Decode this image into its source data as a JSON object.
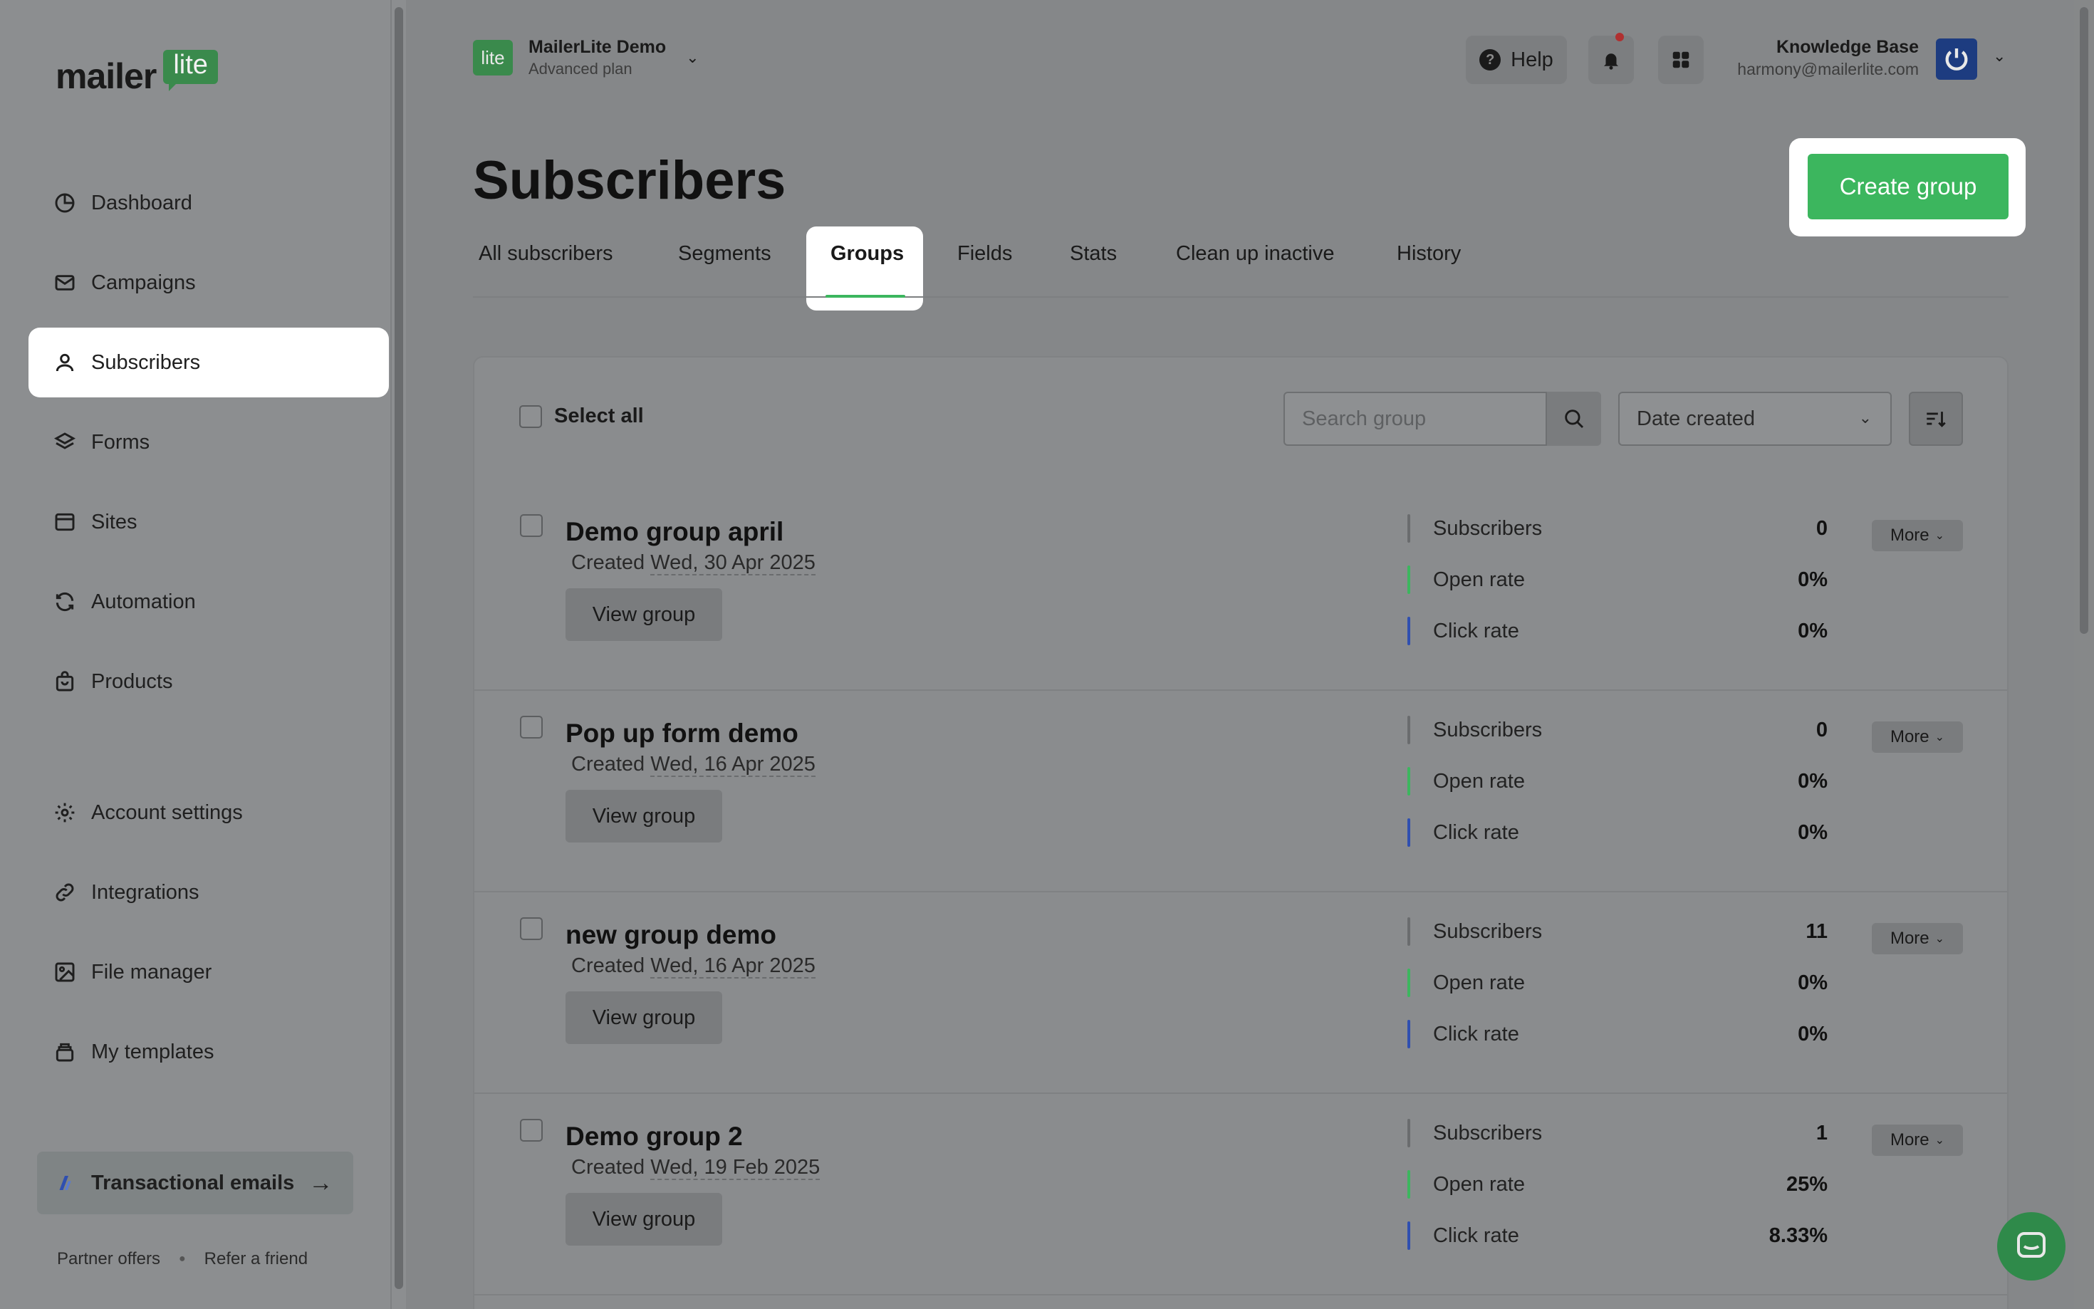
{
  "sidebar": {
    "logo": {
      "word": "mailer",
      "badge": "lite"
    },
    "items": [
      {
        "label": "Dashboard",
        "icon": "dashboard-icon"
      },
      {
        "label": "Campaigns",
        "icon": "mail-icon"
      },
      {
        "label": "Subscribers",
        "icon": "user-icon",
        "active": true
      },
      {
        "label": "Forms",
        "icon": "layers-icon"
      },
      {
        "label": "Sites",
        "icon": "browser-icon"
      },
      {
        "label": "Automation",
        "icon": "refresh-icon"
      },
      {
        "label": "Products",
        "icon": "shopping-bag-icon"
      },
      {
        "label": "Account settings",
        "icon": "gear-icon"
      },
      {
        "label": "Integrations",
        "icon": "link-icon"
      },
      {
        "label": "File manager",
        "icon": "image-icon"
      },
      {
        "label": "My templates",
        "icon": "stack-icon"
      }
    ],
    "transactional": {
      "label": "Transactional emails",
      "arrow": "→"
    },
    "footer": {
      "partner": "Partner offers",
      "refer": "Refer a friend"
    }
  },
  "topbar": {
    "account_badge": "lite",
    "account_name": "MailerLite Demo",
    "account_plan": "Advanced plan",
    "help_label": "Help",
    "user_name": "Knowledge Base",
    "user_email": "harmony@mailerlite.com"
  },
  "page": {
    "title": "Subscribers",
    "create_label": "Create group",
    "tabs": [
      "All subscribers",
      "Segments",
      "Groups",
      "Fields",
      "Stats",
      "Clean up inactive",
      "History"
    ],
    "active_tab": "Groups"
  },
  "toolbar": {
    "select_all": "Select all",
    "search_placeholder": "Search group",
    "sort_value": "Date created"
  },
  "groups": [
    {
      "name": "Demo group april",
      "created_prefix": "Created",
      "created_date": "Wed, 30 Apr 2025",
      "view_label": "View group",
      "stats": {
        "subscribers_label": "Subscribers",
        "subscribers": "0",
        "open_label": "Open rate",
        "open": "0%",
        "click_label": "Click rate",
        "click": "0%"
      },
      "more_label": "More"
    },
    {
      "name": "Pop up form demo",
      "created_prefix": "Created",
      "created_date": "Wed, 16 Apr 2025",
      "view_label": "View group",
      "stats": {
        "subscribers_label": "Subscribers",
        "subscribers": "0",
        "open_label": "Open rate",
        "open": "0%",
        "click_label": "Click rate",
        "click": "0%"
      },
      "more_label": "More"
    },
    {
      "name": "new group demo",
      "created_prefix": "Created",
      "created_date": "Wed, 16 Apr 2025",
      "view_label": "View group",
      "stats": {
        "subscribers_label": "Subscribers",
        "subscribers": "11",
        "open_label": "Open rate",
        "open": "0%",
        "click_label": "Click rate",
        "click": "0%"
      },
      "more_label": "More"
    },
    {
      "name": "Demo group 2",
      "created_prefix": "Created",
      "created_date": "Wed, 19 Feb 2025",
      "view_label": "View group",
      "stats": {
        "subscribers_label": "Subscribers",
        "subscribers": "1",
        "open_label": "Open rate",
        "open": "25%",
        "click_label": "Click rate",
        "click": "8.33%"
      },
      "more_label": "More"
    }
  ],
  "colors": {
    "brand_green": "#3cb65e",
    "open_rate_bar": "#3cb65e",
    "click_rate_bar": "#2f4fb0",
    "subscribers_bar": "#6a6c6e",
    "avatar": "#1d3c80"
  }
}
